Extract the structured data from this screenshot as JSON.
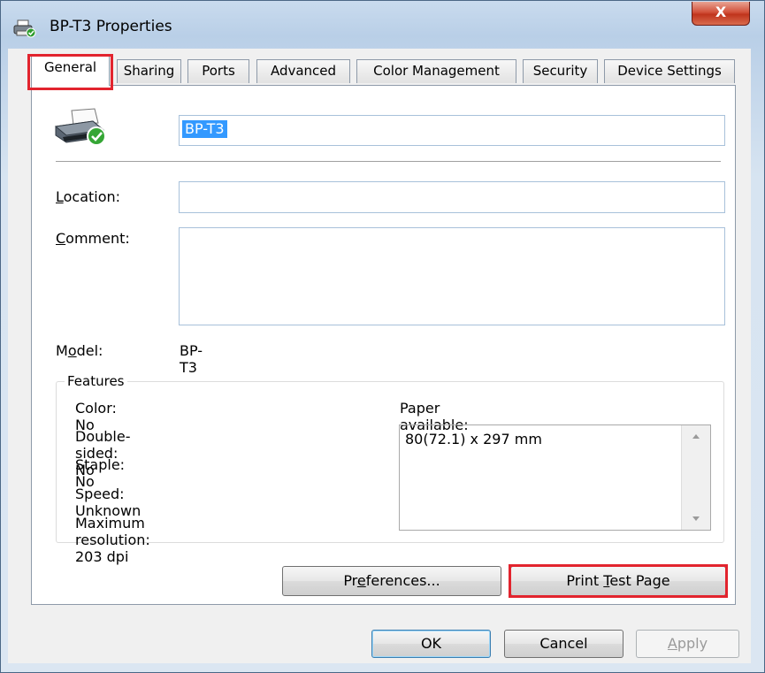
{
  "window": {
    "title": "BP-T3 Properties",
    "close_glyph": "X"
  },
  "tabs": [
    {
      "label": "General"
    },
    {
      "label": "Sharing"
    },
    {
      "label": "Ports"
    },
    {
      "label": "Advanced"
    },
    {
      "label": "Color Management"
    },
    {
      "label": "Security"
    },
    {
      "label": "Device Settings"
    }
  ],
  "general": {
    "printer_name": "BP-T3",
    "location": {
      "label_mn": "L",
      "label_rest": "ocation:",
      "value": ""
    },
    "comment": {
      "label_mn": "C",
      "label_rest": "omment:",
      "value": ""
    },
    "model": {
      "label_pre": "M",
      "label_mn": "o",
      "label_rest": "del:",
      "value": "BP-T3"
    },
    "features": {
      "title": "Features",
      "color": "Color: No",
      "double_sided": "Double-sided: No",
      "staple": "Staple: No",
      "speed": "Speed: Unknown",
      "max_resolution": "Maximum resolution: 203 dpi",
      "paper_label": "Paper available:",
      "paper_items": [
        "80(72.1) x 297 mm"
      ]
    },
    "buttons": {
      "preferences": {
        "pre": "Pr",
        "mn": "e",
        "post": "ferences..."
      },
      "print_test": {
        "pre": "Print ",
        "mn": "T",
        "post": "est Page"
      }
    }
  },
  "footer": {
    "ok": "OK",
    "cancel": "Cancel",
    "apply": {
      "mn": "A",
      "post": "pply"
    }
  },
  "icons": {
    "printer": "printer-check-icon",
    "title": "printer-small-icon"
  },
  "colors": {
    "highlight": "#e2242e",
    "selection": "#3399ff",
    "close": "#c7432a"
  }
}
